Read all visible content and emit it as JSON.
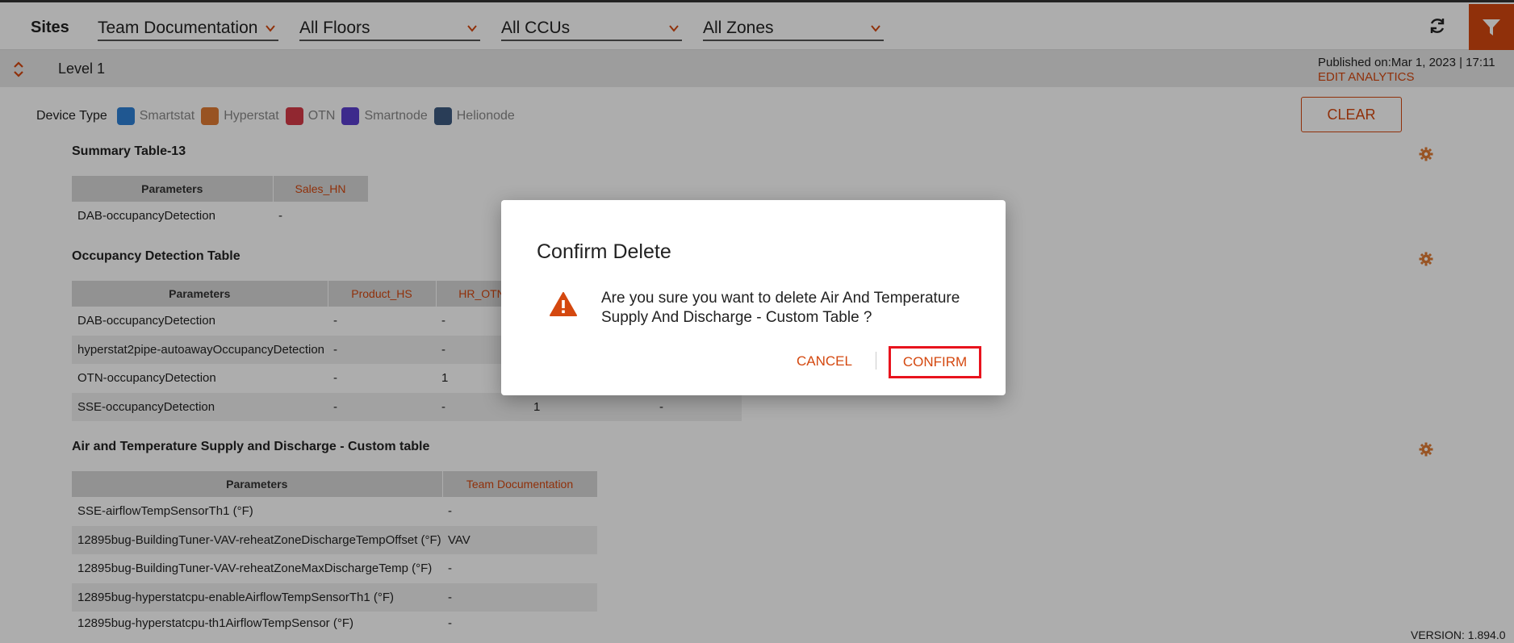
{
  "header": {
    "sites_label": "Sites",
    "site_select": "Team Documentation",
    "floor_select": "All Floors",
    "ccu_select": "All CCUs",
    "zone_select": "All Zones"
  },
  "level_bar": {
    "level": "Level 1",
    "published": "Published on:Mar 1, 2023 | 17:11",
    "edit_analytics": "EDIT ANALYTICS"
  },
  "device_type": {
    "label": "Device Type",
    "items": [
      {
        "name": "Smartstat",
        "color": "#2f80d6"
      },
      {
        "name": "Hyperstat",
        "color": "#e07b33"
      },
      {
        "name": "OTN",
        "color": "#d63a48"
      },
      {
        "name": "Smartnode",
        "color": "#5b3ecf"
      },
      {
        "name": "Helionode",
        "color": "#3d5a80"
      }
    ],
    "clear_label": "CLEAR"
  },
  "summary_table": {
    "title": "Summary Table-13",
    "headers": [
      "Parameters",
      "Sales_HN"
    ],
    "rows": [
      [
        "DAB-occupancyDetection",
        "-"
      ]
    ]
  },
  "occupancy_table": {
    "title": "Occupancy Detection Table",
    "headers": [
      "Parameters",
      "Product_HS",
      "HR_OTN",
      "",
      ""
    ],
    "rows": [
      [
        "DAB-occupancyDetection",
        "-",
        "-",
        "",
        ""
      ],
      [
        "hyperstat2pipe-autoawayOccupancyDetection",
        "-",
        "-",
        "",
        ""
      ],
      [
        "OTN-occupancyDetection",
        "-",
        "1",
        "",
        ""
      ],
      [
        "SSE-occupancyDetection",
        "-",
        "-",
        "1",
        "-"
      ]
    ]
  },
  "custom_table": {
    "title": "Air and Temperature Supply and Discharge - Custom table",
    "headers": [
      "Parameters",
      "Team Documentation"
    ],
    "rows": [
      [
        "SSE-airflowTempSensorTh1 (°F)",
        "-"
      ],
      [
        "12895bug-BuildingTuner-VAV-reheatZoneDischargeTempOffset (°F)",
        "VAV"
      ],
      [
        "12895bug-BuildingTuner-VAV-reheatZoneMaxDischargeTemp (°F)",
        "-"
      ],
      [
        "12895bug-hyperstatcpu-enableAirflowTempSensorTh1 (°F)",
        "-"
      ],
      [
        "12895bug-hyperstatcpu-th1AirflowTempSensor (°F)",
        "-"
      ]
    ]
  },
  "modal": {
    "title": "Confirm Delete",
    "message": "Are you sure you want to delete Air And Temperature Supply And Discharge - Custom Table ?",
    "cancel": "CANCEL",
    "confirm": "CONFIRM"
  },
  "version": "VERSION: 1.894.0",
  "colors": {
    "accent": "#d4480f",
    "highlight": "#e8131d"
  }
}
